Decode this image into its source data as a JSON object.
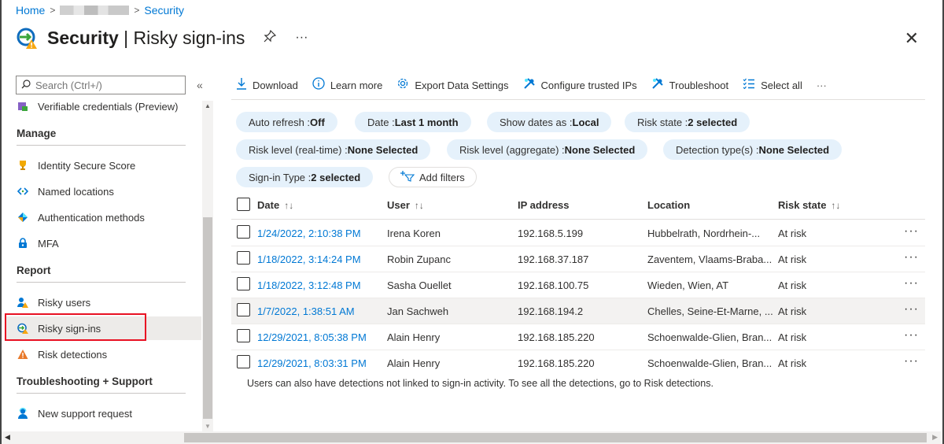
{
  "breadcrumb": {
    "home": "Home",
    "sep": ">",
    "current": "Security"
  },
  "header": {
    "title_main": "Security",
    "title_divider": " | ",
    "title_sub": "Risky sign-ins",
    "pin_icon": "pin-icon",
    "more": "···",
    "close": "✕"
  },
  "sidebar": {
    "search_placeholder": "Search (Ctrl+/)",
    "collapse": "«",
    "items": [
      {
        "label": "Verifiable credentials (Preview)",
        "icon": "credentials-icon"
      },
      {
        "section": "Manage"
      },
      {
        "label": "Identity Secure Score",
        "icon": "trophy-icon"
      },
      {
        "label": "Named locations",
        "icon": "named-locations-icon"
      },
      {
        "label": "Authentication methods",
        "icon": "auth-methods-icon"
      },
      {
        "label": "MFA",
        "icon": "mfa-icon"
      },
      {
        "section": "Report"
      },
      {
        "label": "Risky users",
        "icon": "risky-users-icon"
      },
      {
        "label": "Risky sign-ins",
        "icon": "risky-signins-icon",
        "active": true
      },
      {
        "label": "Risk detections",
        "icon": "warning-icon"
      },
      {
        "section": "Troubleshooting + Support"
      },
      {
        "label": "New support request",
        "icon": "support-request-icon"
      }
    ]
  },
  "toolbar": {
    "download": "Download",
    "learn_more": "Learn more",
    "export": "Export Data Settings",
    "trusted_ips": "Configure trusted IPs",
    "troubleshoot": "Troubleshoot",
    "select_all": "Select all",
    "more": "···"
  },
  "filters": [
    {
      "label": "Auto refresh : ",
      "value": "Off"
    },
    {
      "label": "Date : ",
      "value": "Last 1 month"
    },
    {
      "label": "Show dates as : ",
      "value": "Local"
    },
    {
      "label": "Risk state : ",
      "value": "2 selected"
    },
    {
      "label": "Risk level (real-time) : ",
      "value": "None Selected"
    },
    {
      "label": "Risk level (aggregate) : ",
      "value": "None Selected"
    },
    {
      "label": "Detection type(s) : ",
      "value": "None Selected"
    },
    {
      "label": "Sign-in Type : ",
      "value": "2 selected"
    }
  ],
  "add_filters": "Add filters",
  "table": {
    "columns": {
      "date": "Date",
      "user": "User",
      "ip": "IP address",
      "location": "Location",
      "risk_state": "Risk state"
    },
    "sort_glyph": "↑↓",
    "rows": [
      {
        "date": "1/24/2022, 2:10:38 PM",
        "user": "Irena Koren",
        "ip": "192.168.5.199",
        "location": "Hubbelrath, Nordrhein-...",
        "risk_state": "At risk"
      },
      {
        "date": "1/18/2022, 3:14:24 PM",
        "user": "Robin Zupanc",
        "ip": "192.168.37.187",
        "location": "Zaventem, Vlaams-Braba...",
        "risk_state": "At risk"
      },
      {
        "date": "1/18/2022, 3:12:48 PM",
        "user": "Sasha Ouellet",
        "ip": "192.168.100.75",
        "location": "Wieden, Wien, AT",
        "risk_state": "At risk"
      },
      {
        "date": "1/7/2022, 1:38:51 AM",
        "user": "Jan Sachweh",
        "ip": "192.168.194.2",
        "location": "Chelles, Seine-Et-Marne, ...",
        "risk_state": "At risk"
      },
      {
        "date": "12/29/2021, 8:05:38 PM",
        "user": "Alain Henry",
        "ip": "192.168.185.220",
        "location": "Schoenwalde-Glien, Bran...",
        "risk_state": "At risk"
      },
      {
        "date": "12/29/2021, 8:03:31 PM",
        "user": "Alain Henry",
        "ip": "192.168.185.220",
        "location": "Schoenwalde-Glien, Bran...",
        "risk_state": "At risk"
      }
    ],
    "row_more": "···"
  },
  "footnote": "Users can also have detections not linked to sign-in activity. To see all the detections, go to Risk detections.",
  "colors": {
    "accent": "#0078d4",
    "pill": "#e5f1fb",
    "highlight": "#e81123",
    "warning": "#f7a711"
  }
}
